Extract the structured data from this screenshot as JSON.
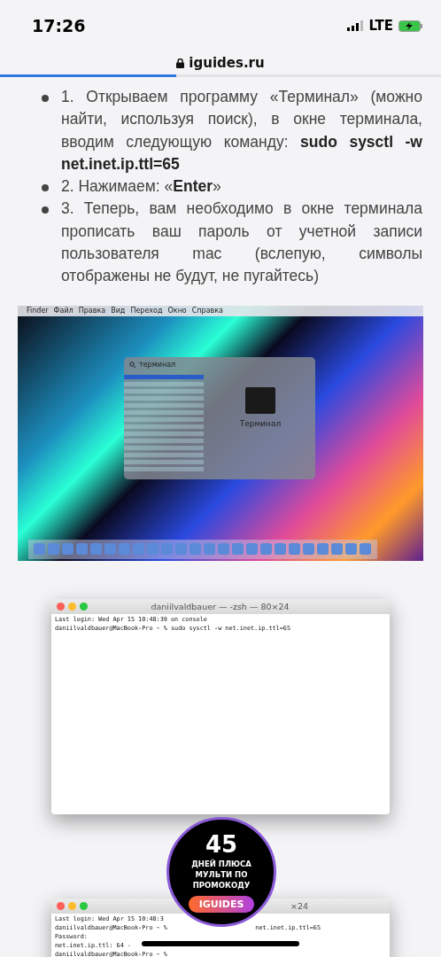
{
  "status_bar": {
    "time": "17:26",
    "network": "LTE"
  },
  "address_bar": {
    "domain": "iguides.ru",
    "load_progress": {
      "level": 0.4
    }
  },
  "steps": [
    "1. Открываем программу «Терминал» (можно найти, используя поиск), в окне терминала, вводим следующую команду: **sudo sysctl -w net.inet.ip.ttl=65**",
    "2. Нажимаем: «**Enter**»",
    "3. Теперь, вам необходимо в окне терминала прописать ваш пароль от учетной записи пользователя mac (вслепую, символы отображены не будут, не пугайтесь)"
  ],
  "desktop_screenshot": {
    "menu": [
      "Finder",
      "Файл",
      "Правка",
      "Вид",
      "Переход",
      "Окно",
      "Справка"
    ],
    "spotlight": {
      "query": "терминал",
      "app_name": "Терминал",
      "results": [
        {
          "selected": true
        },
        {
          "selected": false
        },
        {
          "selected": false
        },
        {
          "selected": false
        },
        {
          "selected": false
        },
        {
          "selected": false
        },
        {
          "selected": false
        },
        {
          "selected": false
        },
        {
          "selected": false
        },
        {
          "selected": false
        },
        {
          "selected": false
        },
        {
          "selected": false
        },
        {
          "selected": false
        },
        {
          "selected": false
        }
      ]
    }
  },
  "terminal_1": {
    "title": "daniilvaldbauer — -zsh — 80×24",
    "lines": [
      "Last login: Wed Apr 15 10:48:39 on console",
      "daniilvaldbauer@MacBook-Pro ~ % sudo sysctl -w net.inet.ip.ttl=65"
    ]
  },
  "promo": {
    "number": "45",
    "text": "ДНЕЙ ПЛЮСА МУЛЬТИ ПО ПРОМОКОДУ",
    "code": "IGUIDES"
  },
  "terminal_2": {
    "title_tail": "×24",
    "lines": [
      [
        "Last login: Wed Apr 15 10:48:3"
      ],
      [
        "daniilvaldbauer@MacBook-Pro ~ % ",
        "net.inet.ip.ttl=65"
      ],
      [
        "Password:"
      ],
      [
        "net.inet.ip.ttl: 64 -"
      ],
      [
        "daniilvaldbauer@MacBook-Pro ~ %"
      ]
    ]
  }
}
